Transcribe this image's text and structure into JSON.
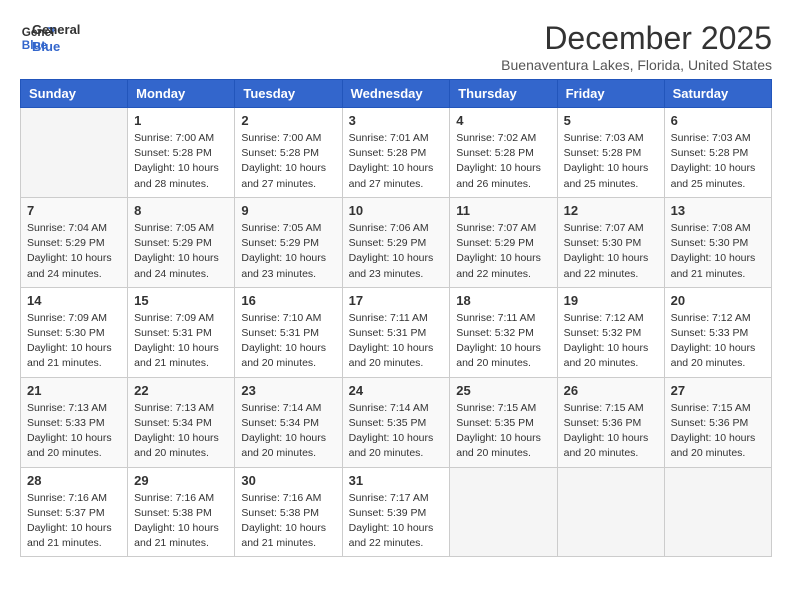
{
  "header": {
    "logo_line1": "General",
    "logo_line2": "Blue",
    "month_year": "December 2025",
    "location": "Buenaventura Lakes, Florida, United States"
  },
  "weekdays": [
    "Sunday",
    "Monday",
    "Tuesday",
    "Wednesday",
    "Thursday",
    "Friday",
    "Saturday"
  ],
  "weeks": [
    [
      {
        "day": "",
        "sunrise": "",
        "sunset": "",
        "daylight": ""
      },
      {
        "day": "1",
        "sunrise": "Sunrise: 7:00 AM",
        "sunset": "Sunset: 5:28 PM",
        "daylight": "Daylight: 10 hours and 28 minutes."
      },
      {
        "day": "2",
        "sunrise": "Sunrise: 7:00 AM",
        "sunset": "Sunset: 5:28 PM",
        "daylight": "Daylight: 10 hours and 27 minutes."
      },
      {
        "day": "3",
        "sunrise": "Sunrise: 7:01 AM",
        "sunset": "Sunset: 5:28 PM",
        "daylight": "Daylight: 10 hours and 27 minutes."
      },
      {
        "day": "4",
        "sunrise": "Sunrise: 7:02 AM",
        "sunset": "Sunset: 5:28 PM",
        "daylight": "Daylight: 10 hours and 26 minutes."
      },
      {
        "day": "5",
        "sunrise": "Sunrise: 7:03 AM",
        "sunset": "Sunset: 5:28 PM",
        "daylight": "Daylight: 10 hours and 25 minutes."
      },
      {
        "day": "6",
        "sunrise": "Sunrise: 7:03 AM",
        "sunset": "Sunset: 5:28 PM",
        "daylight": "Daylight: 10 hours and 25 minutes."
      }
    ],
    [
      {
        "day": "7",
        "sunrise": "Sunrise: 7:04 AM",
        "sunset": "Sunset: 5:29 PM",
        "daylight": "Daylight: 10 hours and 24 minutes."
      },
      {
        "day": "8",
        "sunrise": "Sunrise: 7:05 AM",
        "sunset": "Sunset: 5:29 PM",
        "daylight": "Daylight: 10 hours and 24 minutes."
      },
      {
        "day": "9",
        "sunrise": "Sunrise: 7:05 AM",
        "sunset": "Sunset: 5:29 PM",
        "daylight": "Daylight: 10 hours and 23 minutes."
      },
      {
        "day": "10",
        "sunrise": "Sunrise: 7:06 AM",
        "sunset": "Sunset: 5:29 PM",
        "daylight": "Daylight: 10 hours and 23 minutes."
      },
      {
        "day": "11",
        "sunrise": "Sunrise: 7:07 AM",
        "sunset": "Sunset: 5:29 PM",
        "daylight": "Daylight: 10 hours and 22 minutes."
      },
      {
        "day": "12",
        "sunrise": "Sunrise: 7:07 AM",
        "sunset": "Sunset: 5:30 PM",
        "daylight": "Daylight: 10 hours and 22 minutes."
      },
      {
        "day": "13",
        "sunrise": "Sunrise: 7:08 AM",
        "sunset": "Sunset: 5:30 PM",
        "daylight": "Daylight: 10 hours and 21 minutes."
      }
    ],
    [
      {
        "day": "14",
        "sunrise": "Sunrise: 7:09 AM",
        "sunset": "Sunset: 5:30 PM",
        "daylight": "Daylight: 10 hours and 21 minutes."
      },
      {
        "day": "15",
        "sunrise": "Sunrise: 7:09 AM",
        "sunset": "Sunset: 5:31 PM",
        "daylight": "Daylight: 10 hours and 21 minutes."
      },
      {
        "day": "16",
        "sunrise": "Sunrise: 7:10 AM",
        "sunset": "Sunset: 5:31 PM",
        "daylight": "Daylight: 10 hours and 20 minutes."
      },
      {
        "day": "17",
        "sunrise": "Sunrise: 7:11 AM",
        "sunset": "Sunset: 5:31 PM",
        "daylight": "Daylight: 10 hours and 20 minutes."
      },
      {
        "day": "18",
        "sunrise": "Sunrise: 7:11 AM",
        "sunset": "Sunset: 5:32 PM",
        "daylight": "Daylight: 10 hours and 20 minutes."
      },
      {
        "day": "19",
        "sunrise": "Sunrise: 7:12 AM",
        "sunset": "Sunset: 5:32 PM",
        "daylight": "Daylight: 10 hours and 20 minutes."
      },
      {
        "day": "20",
        "sunrise": "Sunrise: 7:12 AM",
        "sunset": "Sunset: 5:33 PM",
        "daylight": "Daylight: 10 hours and 20 minutes."
      }
    ],
    [
      {
        "day": "21",
        "sunrise": "Sunrise: 7:13 AM",
        "sunset": "Sunset: 5:33 PM",
        "daylight": "Daylight: 10 hours and 20 minutes."
      },
      {
        "day": "22",
        "sunrise": "Sunrise: 7:13 AM",
        "sunset": "Sunset: 5:34 PM",
        "daylight": "Daylight: 10 hours and 20 minutes."
      },
      {
        "day": "23",
        "sunrise": "Sunrise: 7:14 AM",
        "sunset": "Sunset: 5:34 PM",
        "daylight": "Daylight: 10 hours and 20 minutes."
      },
      {
        "day": "24",
        "sunrise": "Sunrise: 7:14 AM",
        "sunset": "Sunset: 5:35 PM",
        "daylight": "Daylight: 10 hours and 20 minutes."
      },
      {
        "day": "25",
        "sunrise": "Sunrise: 7:15 AM",
        "sunset": "Sunset: 5:35 PM",
        "daylight": "Daylight: 10 hours and 20 minutes."
      },
      {
        "day": "26",
        "sunrise": "Sunrise: 7:15 AM",
        "sunset": "Sunset: 5:36 PM",
        "daylight": "Daylight: 10 hours and 20 minutes."
      },
      {
        "day": "27",
        "sunrise": "Sunrise: 7:15 AM",
        "sunset": "Sunset: 5:36 PM",
        "daylight": "Daylight: 10 hours and 20 minutes."
      }
    ],
    [
      {
        "day": "28",
        "sunrise": "Sunrise: 7:16 AM",
        "sunset": "Sunset: 5:37 PM",
        "daylight": "Daylight: 10 hours and 21 minutes."
      },
      {
        "day": "29",
        "sunrise": "Sunrise: 7:16 AM",
        "sunset": "Sunset: 5:38 PM",
        "daylight": "Daylight: 10 hours and 21 minutes."
      },
      {
        "day": "30",
        "sunrise": "Sunrise: 7:16 AM",
        "sunset": "Sunset: 5:38 PM",
        "daylight": "Daylight: 10 hours and 21 minutes."
      },
      {
        "day": "31",
        "sunrise": "Sunrise: 7:17 AM",
        "sunset": "Sunset: 5:39 PM",
        "daylight": "Daylight: 10 hours and 22 minutes."
      },
      {
        "day": "",
        "sunrise": "",
        "sunset": "",
        "daylight": ""
      },
      {
        "day": "",
        "sunrise": "",
        "sunset": "",
        "daylight": ""
      },
      {
        "day": "",
        "sunrise": "",
        "sunset": "",
        "daylight": ""
      }
    ]
  ]
}
